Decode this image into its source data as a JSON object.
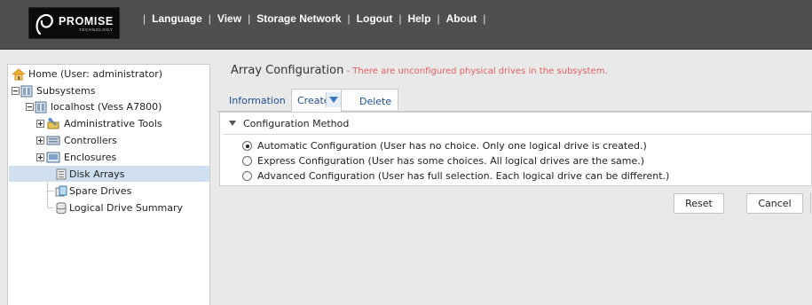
{
  "brand": {
    "name": "PROMISE",
    "tagline": "TECHNOLOGY"
  },
  "nav": [
    "Language",
    "View",
    "Storage Network",
    "Logout",
    "Help",
    "About"
  ],
  "tree": {
    "home": "Home (User: administrator)",
    "subsystems": "Subsystems",
    "localhost": "localhost (Vess A7800)",
    "admin_tools": "Administrative Tools",
    "controllers": "Controllers",
    "enclosures": "Enclosures",
    "disk_arrays": "Disk Arrays",
    "spare_drives": "Spare Drives",
    "logical_summary": "Logical Drive Summary",
    "selected": "Disk Arrays"
  },
  "page": {
    "title": "Array Configuration",
    "message": " - There are unconfigured physical drives in the subsystem."
  },
  "tabs": {
    "information": "Information",
    "create": "Create",
    "delete": "Delete",
    "active": "Create"
  },
  "config": {
    "heading": "Configuration Method",
    "options": [
      "Automatic Configuration (User has no choice. Only one logical drive is created.)",
      "Express Configuration (User has some choices. All logical drives are the same.)",
      "Advanced Configuration (User has full selection. Each logical drive can be different.)"
    ],
    "selected_index": 0
  },
  "buttons": {
    "reset": "Reset",
    "cancel": "Cancel"
  },
  "colors": {
    "header_bg": "#4f4f4f",
    "accent_blue": "#1f4f8f",
    "warning_text": "#e06060",
    "selection": "#cfdff0"
  }
}
